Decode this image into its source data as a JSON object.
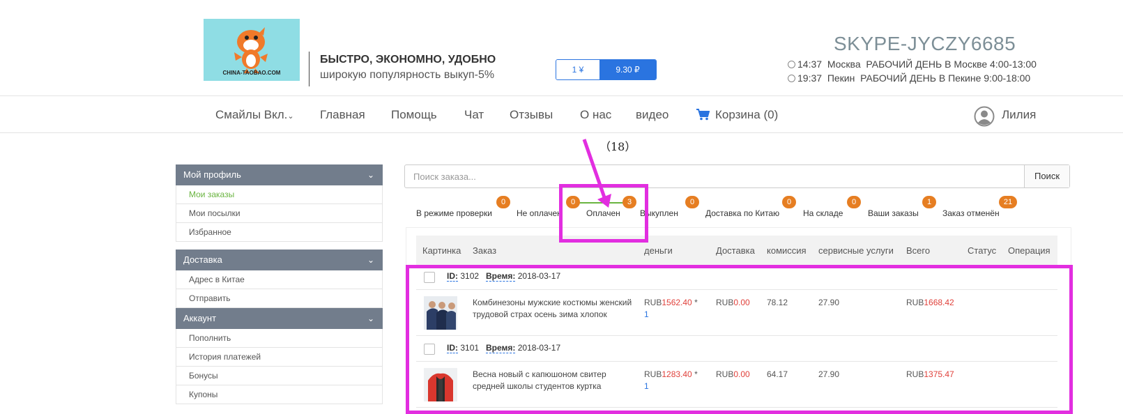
{
  "header": {
    "logo_text": "CHINA-TAOBAO.COM",
    "slogan_bold": "БЫСТРО, ЭКОНОМНО, УДОБНО",
    "slogan_sub": "широкую популярность выкуп-5%",
    "rate_cny": "1 ¥",
    "rate_rub": "9.30 ₽",
    "skype": "SKYPE-JYCZY6685",
    "times": [
      {
        "time": "14:37",
        "city": "Москва",
        "schedule": "РАБОЧИЙ ДЕНЬ В Москве 4:00-13:00"
      },
      {
        "time": "19:37",
        "city": "Пекин",
        "schedule": "РАБОЧИЙ ДЕНЬ В Пекине 9:00-18:00"
      }
    ]
  },
  "nav": {
    "items": [
      "Смайлы Вкл.",
      "Главная",
      "Помощь",
      "Чат",
      "Отзывы",
      "О нас",
      "видео"
    ],
    "cart_label": "Корзина",
    "cart_count": "(0)",
    "user": "Лилия"
  },
  "annotation": {
    "count": "（18）"
  },
  "sidebar": {
    "sections": [
      {
        "title": "Мой профиль",
        "items": [
          "Мои заказы",
          "Мои посылки",
          "Избранное"
        ]
      },
      {
        "title": "Доставка",
        "items": [
          "Адрес в Китае",
          "Отправить"
        ]
      },
      {
        "title": "Аккаунт",
        "items": [
          "Пополнить",
          "История платежей",
          "Бонусы",
          "Купоны"
        ]
      }
    ]
  },
  "search": {
    "placeholder": "Поиск заказа...",
    "button": "Поиск"
  },
  "tabs": [
    {
      "label": "В режиме проверки",
      "badge": "0"
    },
    {
      "label": "Не оплачен",
      "badge": "0"
    },
    {
      "label": "Оплачен",
      "badge": "3"
    },
    {
      "label": "Выкуплен",
      "badge": "0"
    },
    {
      "label": "Доставка по Китаю",
      "badge": "0"
    },
    {
      "label": "На складе",
      "badge": "0"
    },
    {
      "label": "Ваши заказы",
      "badge": "1"
    },
    {
      "label": "Заказ отменён",
      "badge": "21"
    }
  ],
  "table": {
    "headers": [
      "Картинка",
      "Заказ",
      "деньги",
      "Доставка",
      "комиссия",
      "сервисные услуги",
      "Всего",
      "Статус",
      "Операция"
    ],
    "id_label": "ID:",
    "time_label": "Время:",
    "currency": "RUB",
    "orders": [
      {
        "id": "3102",
        "date": "2018-03-17",
        "title": "Комбинезоны мужские костюмы женский трудовой страх осень зима хлопок",
        "price": "1562.40",
        "qty_sep": " *",
        "qty": "1",
        "delivery": "0.00",
        "commission": "78.12",
        "service": "27.90",
        "total": "1668.42"
      },
      {
        "id": "3101",
        "date": "2018-03-17",
        "title": "Весна новый с капюшоном свитер средней школы студентов куртка",
        "price": "1283.40",
        "qty_sep": " *",
        "qty": "1",
        "delivery": "0.00",
        "commission": "64.17",
        "service": "27.90",
        "total": "1375.47"
      }
    ]
  },
  "colors": {
    "accent": "#2a74e0",
    "badge": "#e67e22",
    "active_green": "#6ab440",
    "highlight": "#e22ee0",
    "sidebar_head": "#727d8c",
    "money_red": "#e0413b"
  }
}
